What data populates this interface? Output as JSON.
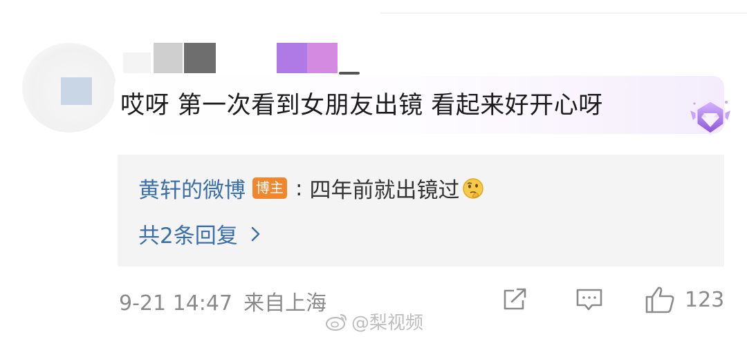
{
  "comment": {
    "text": "哎呀 第一次看到女朋友出镜 看起来好开心呀"
  },
  "reply": {
    "author": "黄轩的微博",
    "owner_tag": "博主",
    "colon": ":",
    "text": "四年前就出镜过",
    "emoji": "thinking-emoji"
  },
  "more_replies": {
    "label": "共2条回复"
  },
  "footer": {
    "time": "9-21 14:47",
    "location": "来自上海",
    "like_count": "123"
  },
  "watermark": {
    "text": "@梨视频"
  },
  "icons": {
    "share": "share-icon",
    "comment": "comment-icon",
    "like": "thumbs-up-icon",
    "badge": "diamond-badge-icon",
    "chevron": "chevron-right-icon",
    "weibo": "weibo-logo-icon"
  },
  "colors": {
    "link": "#3b6fa7",
    "owner_tag": "#f0862e",
    "meta": "#8a8a8a",
    "reply_bg": "#f4f4f4",
    "badge": "#a06ee0"
  }
}
